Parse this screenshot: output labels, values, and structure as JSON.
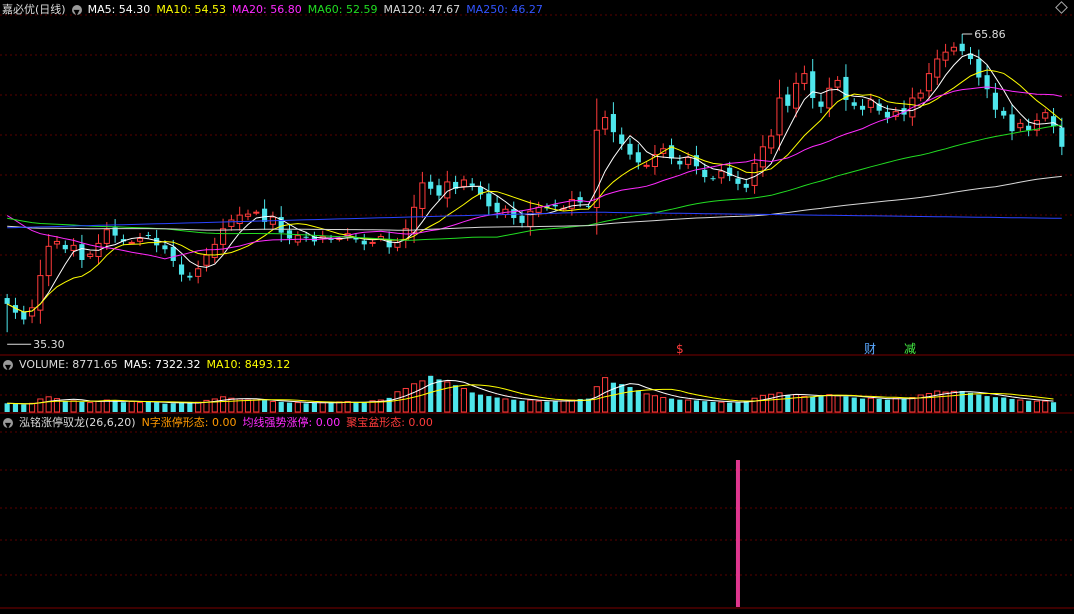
{
  "colors": {
    "up": "#ff3b3b",
    "down": "#4ee6ec",
    "ma5": "#ffffff",
    "ma10": "#ffff00",
    "ma20": "#ff2bff",
    "ma60": "#22dd22",
    "ma120": "#d8d8d8",
    "ma250": "#2a44ff",
    "grid": "#5a0000",
    "bar": "#e0368e"
  },
  "header": {
    "stock": "嘉必优(日线)",
    "ma5": "MA5: 54.30",
    "ma10": "MA10: 54.53",
    "ma20": "MA20: 56.80",
    "ma60": "MA60: 52.59",
    "ma120": "MA120: 47.67",
    "ma250": "MA250: 46.27"
  },
  "volume_header": {
    "label": "VOLUME: 8771.65",
    "ma5": "MA5: 7322.32",
    "ma10": "MA10: 8493.12"
  },
  "indicator_header": {
    "name": "泓铭涨停驭龙(26,6,20)",
    "f1": "N字涨停形态: 0.00",
    "f2": "均线强势涨停: 0.00",
    "f3": "聚宝盆形态: 0.00"
  },
  "markers": {
    "s": "$",
    "cai": "财",
    "jian": "减"
  },
  "chart_data": {
    "type": "candlestick",
    "price_high_label": "65.86",
    "price_low_label": "35.30",
    "price_range": [
      34.5,
      67.5
    ],
    "series_ma250_range": [
      46.0,
      47.6
    ],
    "close": [
      38.2,
      37.3,
      36.6,
      37.8,
      41.1,
      44.1,
      44.6,
      43.8,
      44.2,
      42.7,
      43.3,
      44.4,
      45.8,
      45.2,
      44.6,
      44.5,
      44.9,
      45.2,
      44.2,
      43.8,
      42.6,
      41.2,
      40.9,
      41.8,
      43.2,
      44.3,
      45.9,
      46.8,
      47.3,
      47.4,
      47.6,
      46.6,
      47.1,
      45.5,
      44.9,
      45.2,
      45.0,
      44.6,
      45.1,
      44.8,
      44.9,
      45.4,
      44.8,
      44.3,
      44.5,
      45.1,
      44.0,
      44.5,
      45.9,
      48.1,
      50.6,
      50.0,
      49.3,
      50.7,
      50.0,
      50.9,
      50.3,
      49.4,
      48.2,
      47.6,
      47.9,
      47.0,
      46.5,
      47.7,
      48.1,
      48.0,
      48.2,
      48.0,
      48.9,
      48.6,
      48.2,
      56.0,
      57.3,
      55.8,
      54.6,
      53.5,
      52.7,
      52.4,
      53.5,
      54.1,
      53.1,
      52.5,
      53.2,
      52.3,
      51.2,
      51.0,
      51.8,
      51.3,
      50.5,
      50.1,
      52.6,
      54.3,
      55.4,
      59.3,
      58.5,
      60.8,
      61.8,
      59.3,
      58.4,
      60.3,
      61.1,
      59.1,
      58.5,
      58.1,
      59.1,
      58.0,
      57.3,
      57.9,
      57.6,
      59.3,
      59.8,
      61.8,
      63.3,
      64.0,
      64.5,
      64.1,
      63.3,
      61.4,
      60.2,
      58.1,
      57.5,
      55.9,
      56.7,
      56.0,
      57.0,
      57.8,
      56.4,
      54.3
    ],
    "volume": [
      2400,
      2300,
      2100,
      2400,
      3600,
      4200,
      3700,
      3000,
      3100,
      2800,
      2600,
      3000,
      3300,
      3100,
      2700,
      2900,
      2600,
      3000,
      2600,
      2300,
      2400,
      2500,
      2600,
      2700,
      3200,
      3600,
      4200,
      3800,
      3600,
      3300,
      3300,
      3300,
      2900,
      2800,
      2600,
      2600,
      2400,
      2600,
      2600,
      2500,
      2800,
      2900,
      2700,
      2700,
      3100,
      3300,
      3900,
      5600,
      6500,
      7800,
      8600,
      10000,
      9000,
      8300,
      7400,
      6500,
      5400,
      4800,
      4400,
      4000,
      3600,
      3400,
      3100,
      3300,
      3000,
      2900,
      2900,
      3100,
      3300,
      3600,
      3700,
      7000,
      9500,
      8100,
      7700,
      6900,
      6000,
      5000,
      4500,
      4000,
      3700,
      3400,
      3300,
      3200,
      3000,
      2800,
      2700,
      2600,
      2600,
      3100,
      3800,
      4600,
      4900,
      5300,
      4700,
      4800,
      4300,
      4300,
      4600,
      4800,
      4500,
      4300,
      4000,
      3700,
      3800,
      3600,
      3400,
      3800,
      3700,
      4000,
      4700,
      5100,
      5800,
      5500,
      5700,
      5800,
      5300,
      4800,
      4400,
      4100,
      4000,
      3600,
      3300,
      3100,
      3000,
      3000,
      2700
    ],
    "volume_range": [
      0,
      10500
    ],
    "indicator_bar_index": 88,
    "indicator_bar_value": 1.0
  }
}
